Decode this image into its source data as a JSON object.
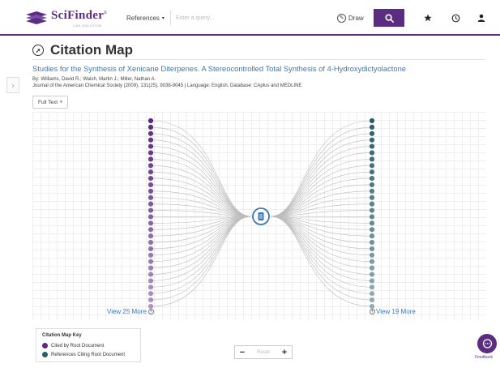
{
  "header": {
    "logo_text": "SciFinder",
    "logo_tm": "n",
    "logo_sub": "CAS SOLUTION",
    "search_type": "References",
    "search_placeholder": "Enter a query...",
    "draw_label": "Draw",
    "icons": [
      "search-icon",
      "star-icon",
      "history-icon",
      "user-icon"
    ]
  },
  "page": {
    "title": "Citation Map",
    "title_icon": "compass-icon"
  },
  "document": {
    "title": "Studies for the Synthesis of Xenicane Diterpenes. A Stereocontrolled Total Synthesis of 4-Hydroxydictyolactone",
    "authors": "By: Williams, David R.; Walsh, Martin J.; Miller, Nathan A.",
    "source": "Journal of the American Chemical Society (2009), 131(25), 9038-9045 | Language: English, Database: CAplus and MEDLINE",
    "full_text_label": "Full Text"
  },
  "map": {
    "view_more_left": "View 25 More",
    "view_more_right": "View 19 More",
    "left_nodes": 30,
    "right_nodes": 30,
    "colors": {
      "cited_by_root": "#5b2a80",
      "citing_root": "#2a5e6b",
      "link": "#bbbbbb",
      "root": "#3a77b5"
    }
  },
  "key": {
    "title": "Citation Map Key",
    "items": [
      {
        "label": "Cited by Root Document",
        "color": "#5b2a80"
      },
      {
        "label": "References Citing Root Document",
        "color": "#2a5e6b"
      }
    ]
  },
  "zoom": {
    "minus": "−",
    "label": "Reset",
    "plus": "+"
  },
  "feedback": {
    "label": "Feedback"
  }
}
